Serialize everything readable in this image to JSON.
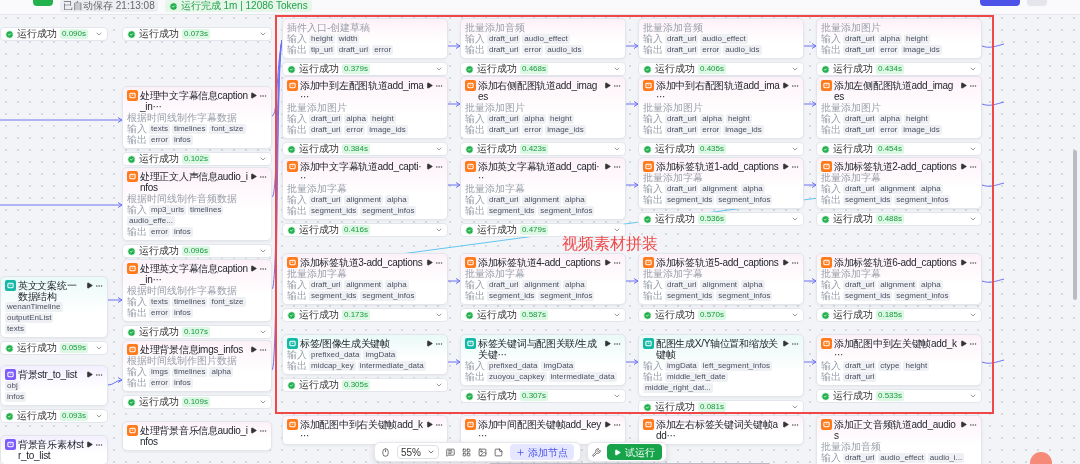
{
  "top_bar": {
    "autosave": "已自动保存 21:13:08",
    "run_status": "运行完成 1m | 12086 Tokens"
  },
  "columns": [
    {
      "nodes": [
        {
          "status": {
            "label": "运行成功",
            "time": "0.090s"
          }
        },
        {
          "kind": "code",
          "title": "英文文案统一数据结构",
          "inputs": {
            "params": [
              "wenanTimeline",
              "outputEnList"
            ]
          },
          "outputs": {
            "params": [
              "texts"
            ]
          },
          "status": {
            "label": "运行成功",
            "time": "0.059s"
          }
        },
        {
          "kind": "workflow",
          "title": "背景str_to_list",
          "inputs": {
            "params": [
              "obj"
            ]
          },
          "outputs": {
            "params": [
              "infos"
            ]
          },
          "status": {
            "label": "运行成功",
            "time": "0.093s"
          }
        },
        {
          "kind": "workflow",
          "title": "背景音乐素材str_to_list"
        }
      ]
    },
    {
      "nodes": [
        {
          "status": {
            "label": "运行成功",
            "time": "0.073s"
          }
        },
        {
          "kind": "plugin",
          "title": "处理中文字幕信息caption_in···",
          "description": "根据时间线制作字幕数据",
          "inputs": {
            "label": "输入",
            "params": [
              "texts",
              "timelines",
              "font_size"
            ]
          },
          "outputs": {
            "label": "输出",
            "params": [
              "error",
              "infos"
            ]
          },
          "status": {
            "label": "运行成功",
            "time": "0.102s"
          }
        },
        {
          "kind": "plugin",
          "title": "处理正文人声信息audio_infos",
          "description": "根据时间线制作音频数据",
          "inputs": {
            "label": "输入",
            "params": [
              "mp3_urls",
              "timelines",
              "audio_effe..."
            ]
          },
          "outputs": {
            "label": "输出",
            "params": [
              "error",
              "infos"
            ]
          },
          "status": {
            "label": "运行成功",
            "time": "0.096s"
          }
        },
        {
          "kind": "plugin",
          "title": "处理英文字幕信息caption_in···",
          "description": "根据时间线制作字幕数据",
          "inputs": {
            "label": "输入",
            "params": [
              "texts",
              "timelines",
              "font_size"
            ]
          },
          "outputs": {
            "label": "输出",
            "params": [
              "error",
              "infos"
            ]
          },
          "status": {
            "label": "运行成功",
            "time": "0.107s"
          }
        },
        {
          "kind": "plugin",
          "title": "处理背景信息imgs_infos",
          "description": "根据时间线制作图片数据",
          "inputs": {
            "label": "输入",
            "params": [
              "imgs",
              "timelines",
              "alpha"
            ]
          },
          "outputs": {
            "label": "输出",
            "params": [
              "error",
              "infos"
            ]
          },
          "status": {
            "label": "运行成功",
            "time": "0.109s"
          }
        },
        {
          "kind": "plugin",
          "title": "处理背景音乐信息audio_infos"
        }
      ]
    },
    {
      "nodes": [
        {
          "kind": "plugin",
          "description": "插件入口-创建草稿",
          "inputs": {
            "label": "输入",
            "params": [
              "height",
              "width"
            ]
          },
          "outputs": {
            "label": "输出",
            "params": [
              "tip_url",
              "draft_url",
              "error"
            ]
          },
          "status": {
            "label": "运行成功",
            "time": "0.379s"
          }
        },
        {
          "kind": "plugin",
          "title": "添加中到左配图轨道add_ima···",
          "description": "批量添加图片",
          "inputs": {
            "label": "输入",
            "params": [
              "draft_url",
              "alpha",
              "height"
            ]
          },
          "outputs": {
            "label": "输出",
            "params": [
              "draft_url",
              "error",
              "image_ids"
            ]
          },
          "status": {
            "label": "运行成功",
            "time": "0.384s"
          }
        },
        {
          "kind": "plugin",
          "title": "添加中文字幕轨道add_capti···",
          "description": "批量添加字幕",
          "inputs": {
            "label": "输入",
            "params": [
              "draft_url",
              "alignment",
              "alpha"
            ]
          },
          "outputs": {
            "label": "输出",
            "params": [
              "segment_ids",
              "segment_infos"
            ]
          },
          "status": {
            "label": "运行成功",
            "time": "0.416s"
          }
        },
        {
          "kind": "plugin",
          "title": "添加标签轨道3-add_captions",
          "description": "批量添加字幕",
          "inputs": {
            "label": "输入",
            "params": [
              "draft_url",
              "alignment",
              "alpha"
            ]
          },
          "outputs": {
            "label": "输出",
            "params": [
              "segment_ids",
              "segment_infos"
            ]
          },
          "status": {
            "label": "运行成功",
            "time": "0.173s"
          }
        },
        {
          "kind": "code",
          "title": "标签/图像生成关键帧",
          "inputs": {
            "label": "输入",
            "params": [
              "prefixed_data",
              "imgData"
            ]
          },
          "outputs": {
            "label": "输出",
            "params": [
              "midcap_key",
              "intermediate_data"
            ]
          },
          "status": {
            "label": "运行成功",
            "time": "0.305s"
          }
        },
        {
          "kind": "plugin",
          "title": "添加配图中到右关键帧add_k···"
        }
      ]
    },
    {
      "nodes": [
        {
          "kind": "plugin",
          "description": "批量添加音频",
          "inputs": {
            "label": "输入",
            "params": [
              "draft_url",
              "audio_effect"
            ]
          },
          "outputs": {
            "label": "输出",
            "params": [
              "draft_url",
              "error",
              "audio_ids"
            ]
          },
          "status": {
            "label": "运行成功",
            "time": "0.468s"
          }
        },
        {
          "kind": "plugin",
          "title": "添加右侧配图轨道add_images",
          "description": "批量添加图片",
          "inputs": {
            "label": "输入",
            "params": [
              "draft_url",
              "alpha",
              "height"
            ]
          },
          "outputs": {
            "label": "输出",
            "params": [
              "draft_url",
              "error",
              "image_ids"
            ]
          },
          "status": {
            "label": "运行成功",
            "time": "0.423s"
          }
        },
        {
          "kind": "plugin",
          "title": "添加英文字幕轨道add_capti···",
          "description": "批量添加字幕",
          "inputs": {
            "label": "输入",
            "params": [
              "draft_url",
              "alignment",
              "alpha"
            ]
          },
          "outputs": {
            "label": "输出",
            "params": [
              "segment_ids",
              "segment_infos"
            ]
          },
          "status": {
            "label": "运行成功",
            "time": "0.479s"
          }
        },
        {
          "kind": "plugin",
          "title": "添加标签轨道4-add_captions",
          "description": "批量添加字幕",
          "inputs": {
            "label": "输入",
            "params": [
              "draft_url",
              "alignment",
              "alpha"
            ]
          },
          "outputs": {
            "label": "输出",
            "params": [
              "segment_ids",
              "segment_infos"
            ]
          },
          "status": {
            "label": "运行成功",
            "time": "0.587s"
          }
        },
        {
          "kind": "code",
          "title": "标签关键词与配图关联/生成关键···",
          "inputs": {
            "label": "输入",
            "params": [
              "prefixed_data",
              "imgData"
            ]
          },
          "outputs": {
            "label": "输出",
            "params": [
              "zuoyou_capkey",
              "intermediate_data"
            ]
          },
          "status": {
            "label": "运行成功",
            "time": "0.307s"
          }
        },
        {
          "kind": "plugin",
          "title": "添加中间配图关键帧add_key···"
        }
      ]
    },
    {
      "nodes": [
        {
          "kind": "plugin",
          "description": "批量添加音频",
          "inputs": {
            "label": "输入",
            "params": [
              "draft_url",
              "audio_effect"
            ]
          },
          "outputs": {
            "label": "输出",
            "params": [
              "draft_url",
              "error",
              "audio_ids"
            ]
          },
          "status": {
            "label": "运行成功",
            "time": "0.406s"
          }
        },
        {
          "kind": "plugin",
          "title": "添加中到右配图轨道add_ima···",
          "description": "批量添加图片",
          "inputs": {
            "label": "输入",
            "params": [
              "draft_url",
              "alpha",
              "height"
            ]
          },
          "outputs": {
            "label": "输出",
            "params": [
              "draft_url",
              "error",
              "image_ids"
            ]
          },
          "status": {
            "label": "运行成功",
            "time": "0.435s"
          }
        },
        {
          "kind": "plugin",
          "title": "添加标签轨道1-add_captions",
          "description": "批量添加字幕",
          "inputs": {
            "label": "输入",
            "params": [
              "draft_url",
              "alignment",
              "alpha"
            ]
          },
          "outputs": {
            "label": "输出",
            "params": [
              "segment_ids",
              "segment_infos"
            ]
          },
          "status": {
            "label": "运行成功",
            "time": "0.536s"
          }
        },
        {
          "kind": "plugin",
          "title": "添加标签轨道5-add_captions",
          "description": "批量添加字幕",
          "inputs": {
            "label": "输入",
            "params": [
              "draft_url",
              "alignment",
              "alpha"
            ]
          },
          "outputs": {
            "label": "输出",
            "params": [
              "segment_ids",
              "segment_infos"
            ]
          },
          "status": {
            "label": "运行成功",
            "time": "0.570s"
          }
        },
        {
          "kind": "code",
          "title": "配图生成X/Y轴位置和缩放关键帧",
          "inputs": {
            "label": "输入",
            "params": [
              "imgData",
              "left_segment_infos"
            ]
          },
          "outputs": {
            "label": "输出",
            "params": [
              "middle_left_date",
              "middle_right_dat..."
            ]
          },
          "status": {
            "label": "运行成功",
            "time": "0.081s"
          }
        },
        {
          "kind": "plugin",
          "title": "添加左右标签关键词关键帧add···"
        }
      ]
    },
    {
      "nodes": [
        {
          "kind": "plugin",
          "description": "批量添加图片",
          "inputs": {
            "label": "输入",
            "params": [
              "draft_url",
              "alpha",
              "height"
            ]
          },
          "outputs": {
            "label": "输出",
            "params": [
              "draft_url",
              "error",
              "image_ids"
            ]
          },
          "status": {
            "label": "运行成功",
            "time": "0.434s"
          }
        },
        {
          "kind": "plugin",
          "title": "添加左侧配图轨道add_images",
          "description": "批量添加图片",
          "inputs": {
            "label": "输入",
            "params": [
              "draft_url",
              "alpha",
              "height"
            ]
          },
          "outputs": {
            "label": "输出",
            "params": [
              "draft_url",
              "error",
              "image_ids"
            ]
          },
          "status": {
            "label": "运行成功",
            "time": "0.454s"
          }
        },
        {
          "kind": "plugin",
          "title": "添加标签轨道2-add_captions",
          "description": "批量添加字幕",
          "inputs": {
            "label": "输入",
            "params": [
              "draft_url",
              "alignment",
              "alpha"
            ]
          },
          "outputs": {
            "label": "输出",
            "params": [
              "segment_ids",
              "segment_infos"
            ]
          },
          "status": {
            "label": "运行成功",
            "time": "0.488s"
          }
        },
        {
          "kind": "plugin",
          "title": "添加标签轨道6-add_captions",
          "description": "批量添加字幕",
          "inputs": {
            "label": "输入",
            "params": [
              "draft_url",
              "alignment",
              "alpha"
            ]
          },
          "outputs": {
            "label": "输出",
            "params": [
              "segment_ids",
              "segment_infos"
            ]
          },
          "status": {
            "label": "运行成功",
            "time": "0.185s"
          }
        },
        {
          "kind": "plugin",
          "title": "添加配图中到左关键帧add_k···",
          "inputs": {
            "label": "输入",
            "params": [
              "draft_url",
              "ctype",
              "height"
            ]
          },
          "outputs": {
            "label": "输出",
            "params": [
              "draft_url"
            ]
          },
          "status": {
            "label": "运行成功",
            "time": "0.533s"
          }
        },
        {
          "kind": "plugin",
          "title": "添加正文音频轨道add_audios",
          "description": "批量添加音频",
          "inputs": {
            "label": "输入",
            "params": [
              "draft_url",
              "audio_effect",
              "audio_i..."
            ]
          }
        }
      ]
    }
  ],
  "annotation": {
    "label": "视频素材拼装"
  },
  "toolbar": {
    "zoom": "55%",
    "add_node": "添加节点",
    "test_run": "试运行"
  }
}
